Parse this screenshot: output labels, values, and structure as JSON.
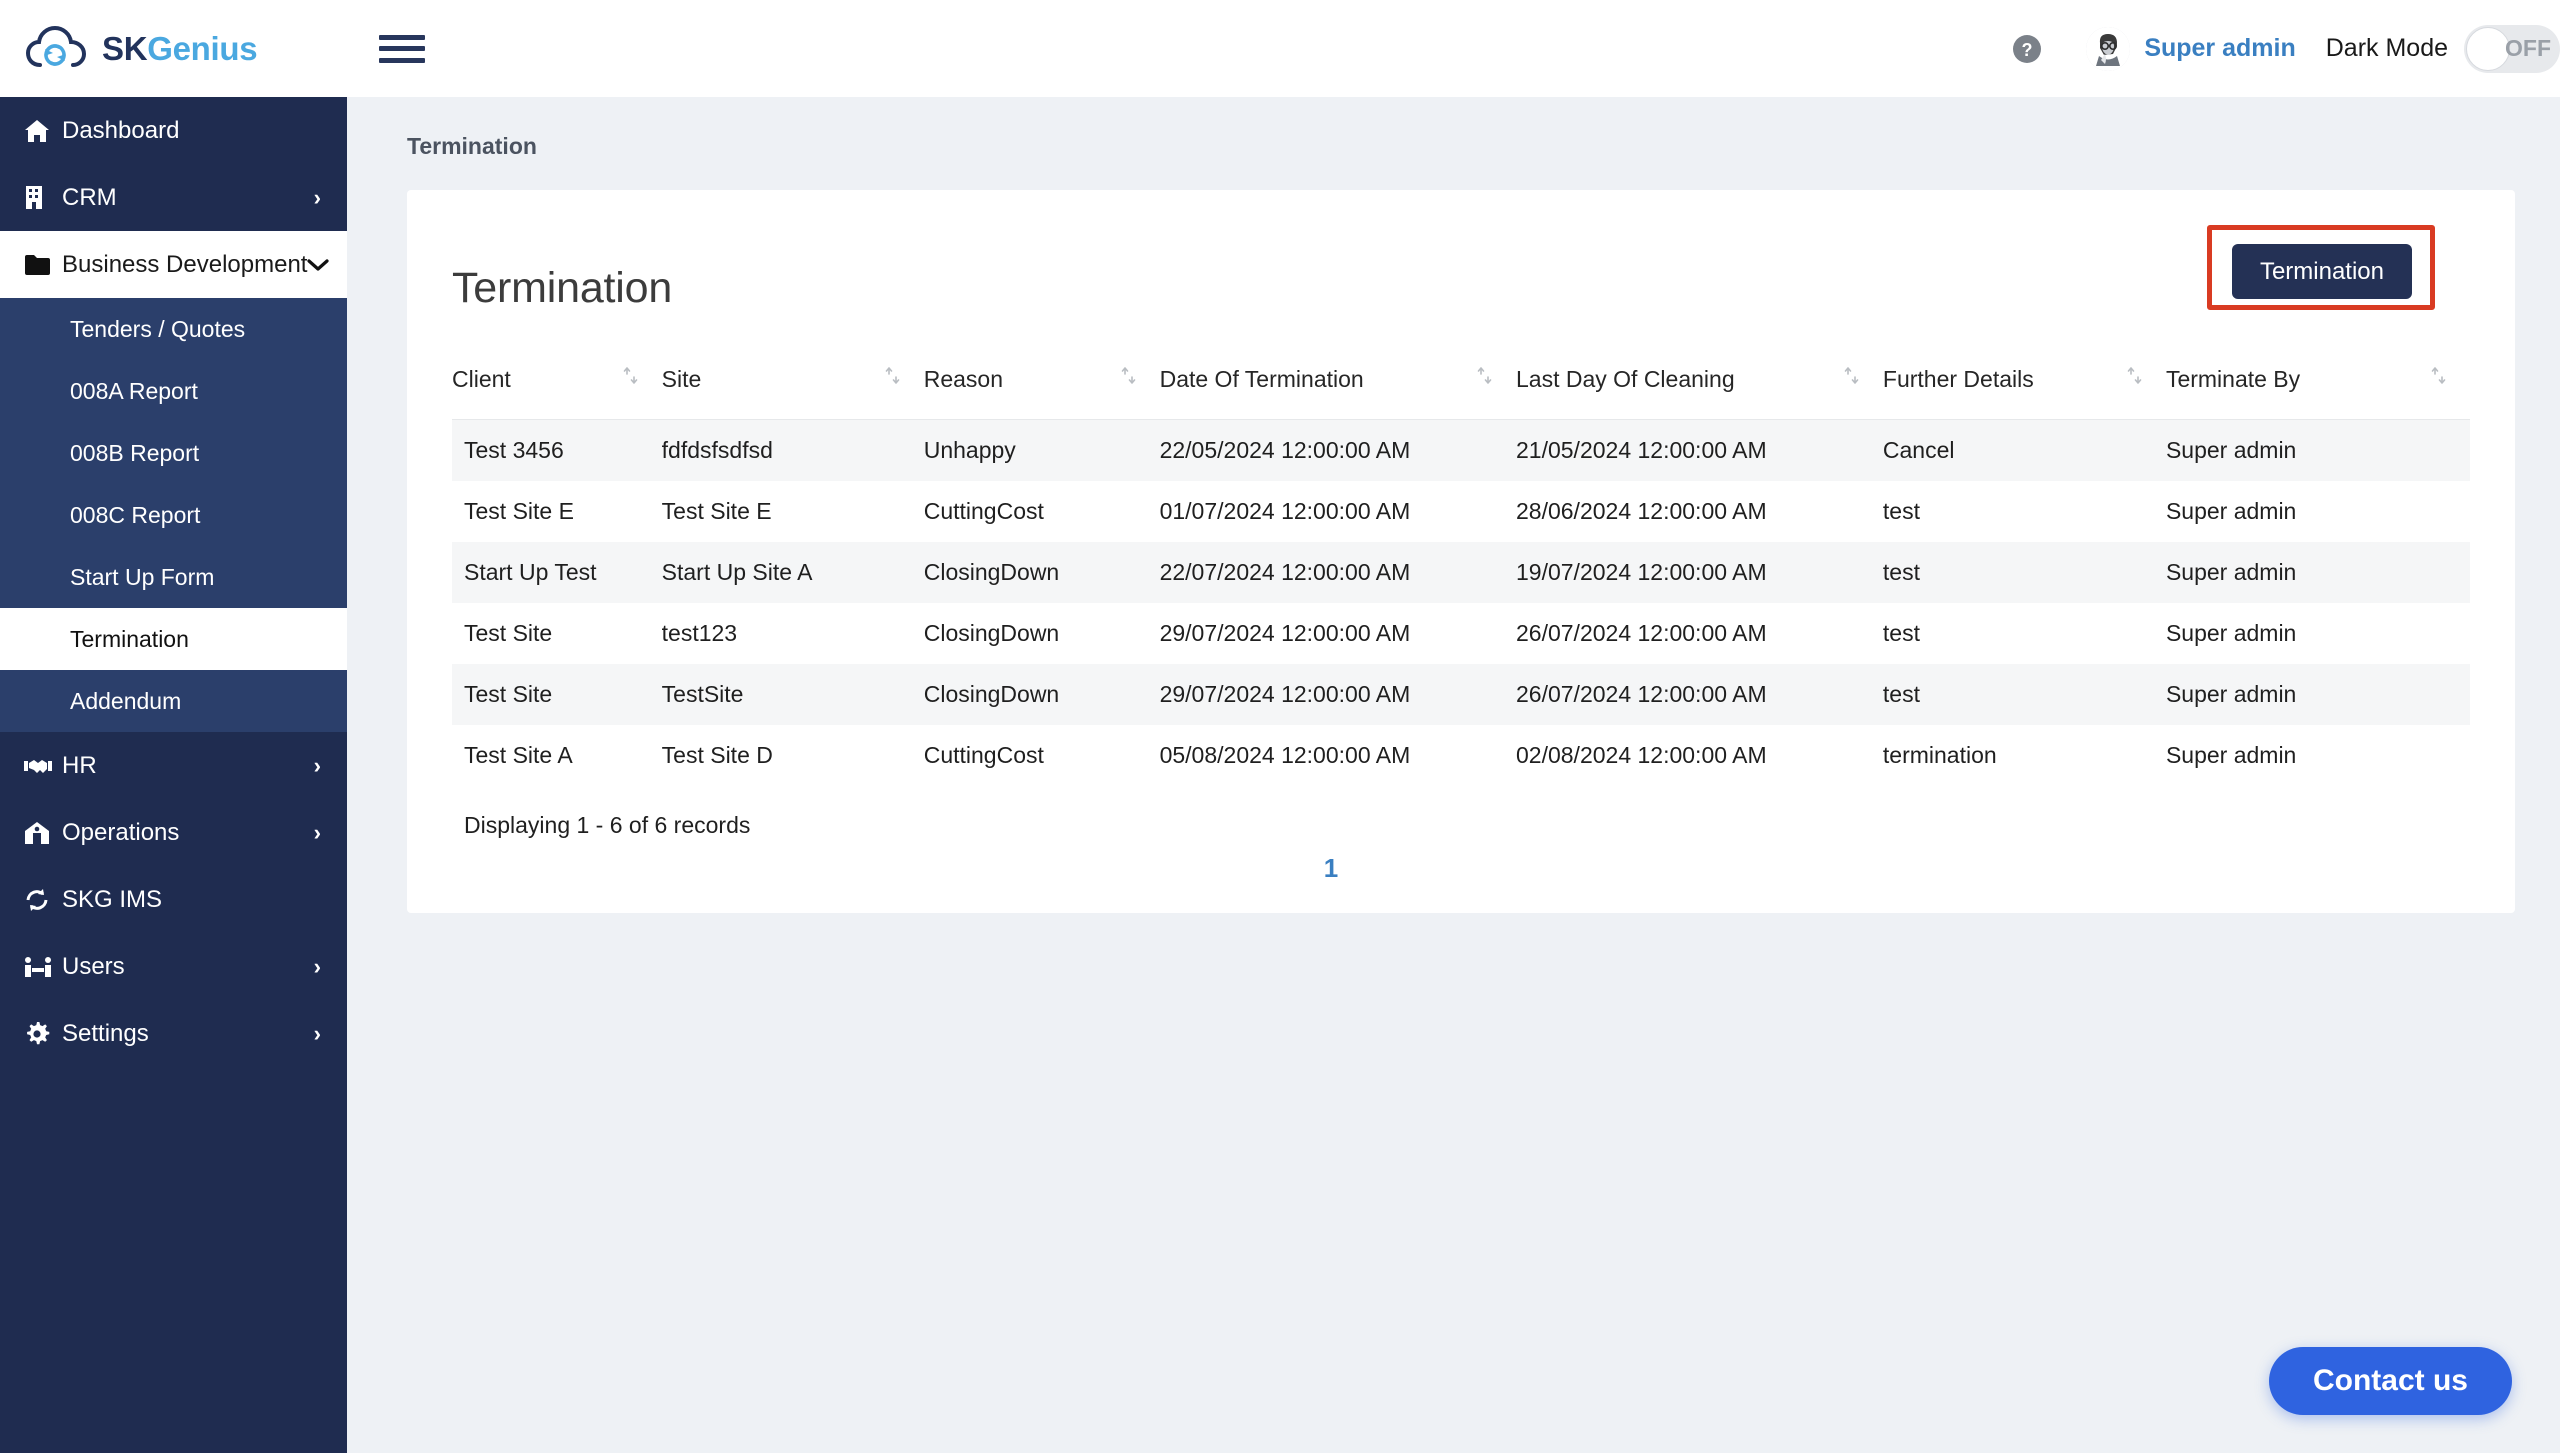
{
  "brand": {
    "name_part1": "SK",
    "name_part2": "Genius",
    "logo_icon": "cloud-sync-icon"
  },
  "header": {
    "menu_toggle_icon": "hamburger-icon",
    "help_icon": "help-circle-icon",
    "avatar_icon": "user-avatar",
    "username": "Super admin",
    "dark_mode_label": "Dark Mode",
    "dark_mode_state": "OFF"
  },
  "sidebar": {
    "items": [
      {
        "label": "Dashboard",
        "icon": "home-icon",
        "chevron": "",
        "active": false
      },
      {
        "label": "CRM",
        "icon": "building-icon",
        "chevron": "›",
        "active": false
      },
      {
        "label": "Business Development",
        "icon": "folder-icon",
        "chevron": "⌄",
        "active": true
      }
    ],
    "submenu": [
      {
        "label": "Tenders / Quotes",
        "active": false
      },
      {
        "label": "008A Report",
        "active": false
      },
      {
        "label": "008B Report",
        "active": false
      },
      {
        "label": "008C Report",
        "active": false
      },
      {
        "label": "Start Up Form",
        "active": false
      },
      {
        "label": "Termination",
        "active": true
      },
      {
        "label": "Addendum",
        "active": false
      }
    ],
    "items_bottom": [
      {
        "label": "HR",
        "icon": "handshake-icon",
        "chevron": "›"
      },
      {
        "label": "Operations",
        "icon": "building-home-icon",
        "chevron": "›"
      },
      {
        "label": "SKG IMS",
        "icon": "sync-icon",
        "chevron": ""
      },
      {
        "label": "Users",
        "icon": "users-icon",
        "chevron": "›"
      },
      {
        "label": "Settings",
        "icon": "gear-icon",
        "chevron": "›"
      }
    ]
  },
  "main": {
    "breadcrumb": "Termination",
    "card_title": "Termination",
    "action_button": "Termination",
    "records_text": "Displaying 1 - 6 of 6 records",
    "pagination": {
      "current": "1"
    },
    "contact_button": "Contact us"
  },
  "table": {
    "columns": [
      "Client",
      "Site",
      "Reason",
      "Date Of Termination",
      "Last Day Of Cleaning",
      "Further Details",
      "Terminate By"
    ],
    "rows": [
      {
        "client": "Test 3456",
        "site": "fdfdsfsdfsd",
        "reason": "Unhappy",
        "date_of_termination": "22/05/2024 12:00:00 AM",
        "last_day_of_cleaning": "21/05/2024 12:00:00 AM",
        "further_details": "Cancel",
        "terminate_by": "Super admin"
      },
      {
        "client": "Test Site E",
        "site": "Test Site E",
        "reason": "CuttingCost",
        "date_of_termination": "01/07/2024 12:00:00 AM",
        "last_day_of_cleaning": "28/06/2024 12:00:00 AM",
        "further_details": "test",
        "terminate_by": "Super admin"
      },
      {
        "client": "Start Up Test",
        "site": "Start Up Site A",
        "reason": "ClosingDown",
        "date_of_termination": "22/07/2024 12:00:00 AM",
        "last_day_of_cleaning": "19/07/2024 12:00:00 AM",
        "further_details": "test",
        "terminate_by": "Super admin"
      },
      {
        "client": "Test Site",
        "site": "test123",
        "reason": "ClosingDown",
        "date_of_termination": "29/07/2024 12:00:00 AM",
        "last_day_of_cleaning": "26/07/2024 12:00:00 AM",
        "further_details": "test",
        "terminate_by": "Super admin"
      },
      {
        "client": "Test Site",
        "site": "TestSite",
        "reason": "ClosingDown",
        "date_of_termination": "29/07/2024 12:00:00 AM",
        "last_day_of_cleaning": "26/07/2024 12:00:00 AM",
        "further_details": "test",
        "terminate_by": "Super admin"
      },
      {
        "client": "Test Site A",
        "site": "Test Site D",
        "reason": "CuttingCost",
        "date_of_termination": "05/08/2024 12:00:00 AM",
        "last_day_of_cleaning": "02/08/2024 12:00:00 AM",
        "further_details": "termination",
        "terminate_by": "Super admin"
      }
    ]
  },
  "colors": {
    "sidebar_bg": "#1f2c50",
    "submenu_bg": "#2b3f6b",
    "accent_blue": "#3a7fc1",
    "button_navy": "#243155",
    "highlight_red": "#d93b22",
    "contact_blue": "#2f63e0",
    "page_bg": "#eef1f5"
  }
}
